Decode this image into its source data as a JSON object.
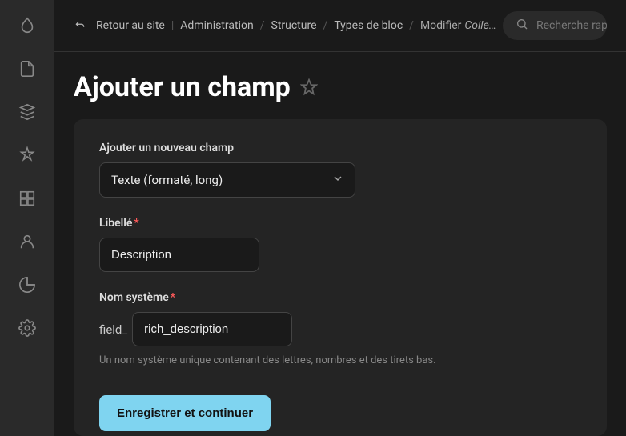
{
  "breadcrumbs": {
    "back": "Retour au site",
    "admin": "Administration",
    "structure": "Structure",
    "block_types": "Types de bloc",
    "modifier": "Modifier",
    "modifier_italic": "Colle…"
  },
  "search": {
    "placeholder": "Recherche rap"
  },
  "page": {
    "title": "Ajouter un champ"
  },
  "form": {
    "add_field_label": "Ajouter un nouveau champ",
    "field_type_value": "Texte (formaté, long)",
    "label_label": "Libellé",
    "label_value": "Description",
    "machine_name_label": "Nom système",
    "machine_name_prefix": "field_",
    "machine_name_value": "rich_description",
    "machine_name_help": "Un nom système unique contenant des lettres, nombres et des tirets bas.",
    "submit": "Enregistrer et continuer"
  }
}
